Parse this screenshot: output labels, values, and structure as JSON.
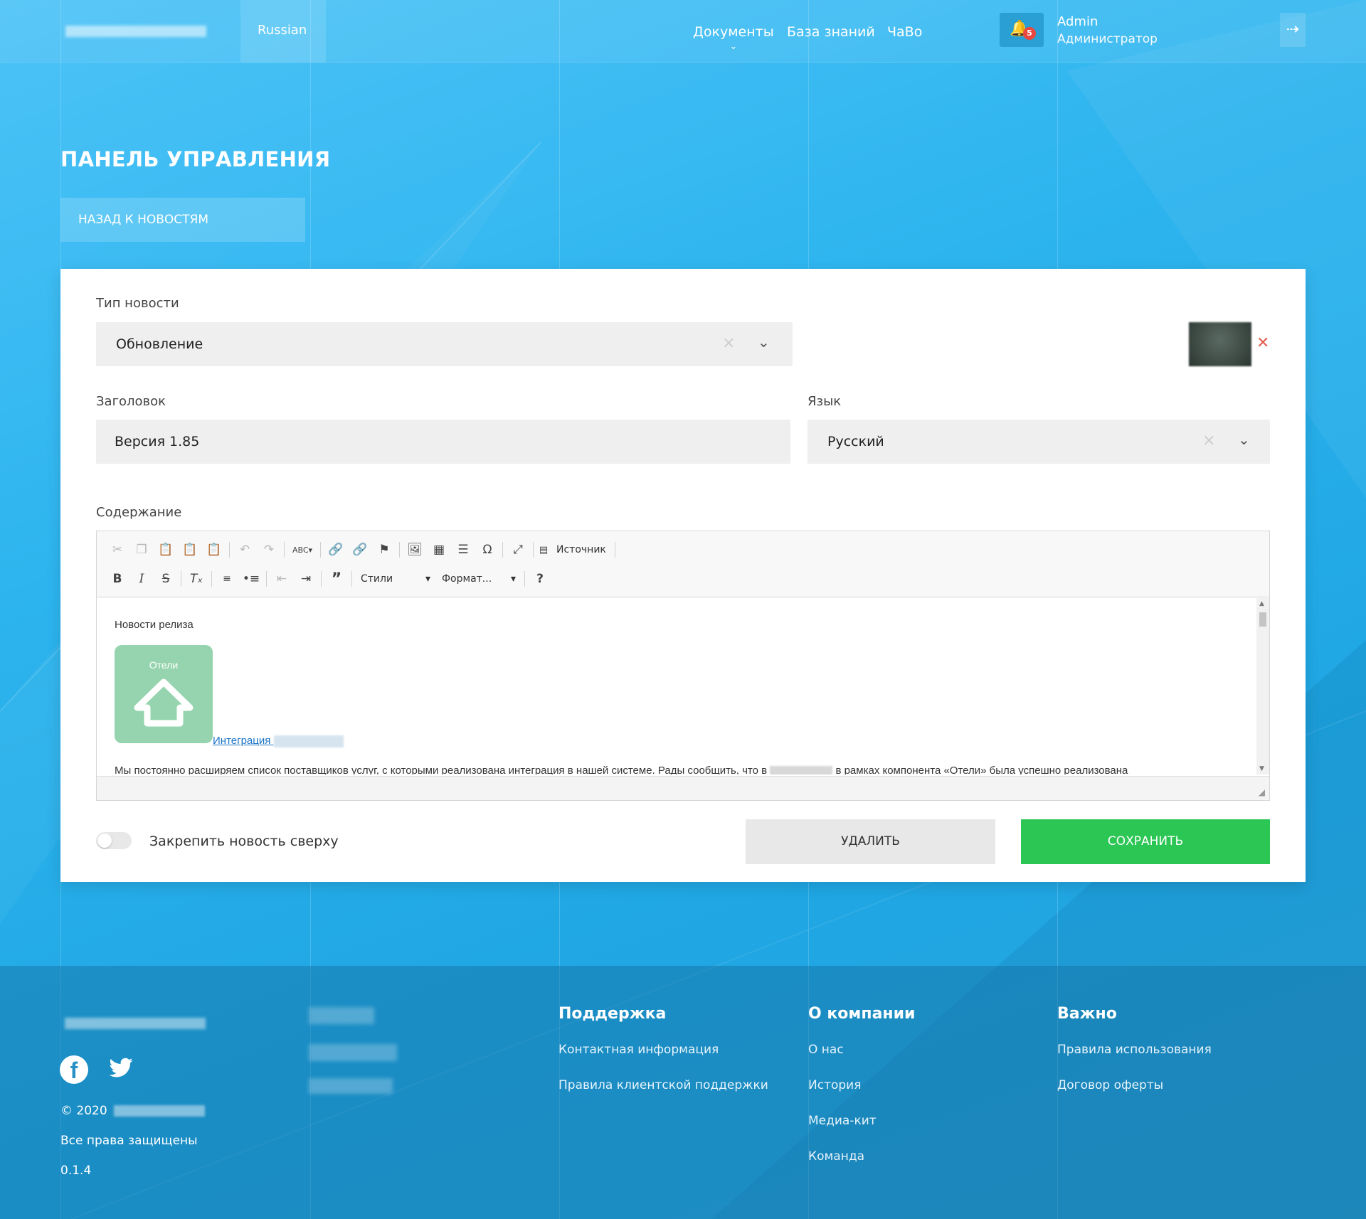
{
  "header": {
    "language": "Russian",
    "nav": [
      {
        "label": "Документы",
        "has_dropdown": true
      },
      {
        "label": "База знаний",
        "has_dropdown": false
      },
      {
        "label": "ЧаВо",
        "has_dropdown": false
      }
    ],
    "notifications_count": "5",
    "user_name": "Admin",
    "user_role": "Администратор",
    "icons": {
      "bell": "bell-icon",
      "exit": "exit-icon"
    }
  },
  "page": {
    "title": "ПАНЕЛЬ УПРАВЛЕНИЯ",
    "back_button": "НАЗАД К НОВОСТЯМ"
  },
  "form": {
    "news_type_label": "Тип новости",
    "news_type_value": "Обновление",
    "title_label": "Заголовок",
    "title_value": "Версия 1.85",
    "language_label": "Язык",
    "language_value": "Русский",
    "content_label": "Содержание",
    "pin_label": "Закрепить новость сверху",
    "pin_enabled": false,
    "delete_button": "УДАЛИТЬ",
    "save_button": "СОХРАНИТЬ"
  },
  "editor": {
    "source_button": "Источник",
    "styles_combo": "Стили",
    "format_combo": "Формат...",
    "help": "?",
    "content": {
      "heading": "Новости релиза",
      "image_caption": "Отели",
      "link_text": "Интеграция",
      "paragraph_start": "Мы постоянно расширяем список поставщиков услуг, с которыми реализована интеграция в нашей системе. Рады сообщить, что в",
      "paragraph_end": "в рамках компонента «Отели» была успешно реализована"
    }
  },
  "footer": {
    "copyright": "© 2020",
    "rights": "Все права защищены",
    "version": "0.1.4",
    "support": {
      "title": "Поддержка",
      "links": [
        "Контактная информация",
        "Правила клиентской поддержки"
      ]
    },
    "company": {
      "title": "О компании",
      "links": [
        "О нас",
        "История",
        "Медиа-кит",
        "Команда"
      ]
    },
    "important": {
      "title": "Важно",
      "links": [
        "Правила использования",
        "Договор оферты"
      ]
    }
  },
  "colors": {
    "background": "#2db4ee",
    "save_green": "#2bc653",
    "badge_red": "#e8483f",
    "link_blue": "#1a73c8"
  }
}
